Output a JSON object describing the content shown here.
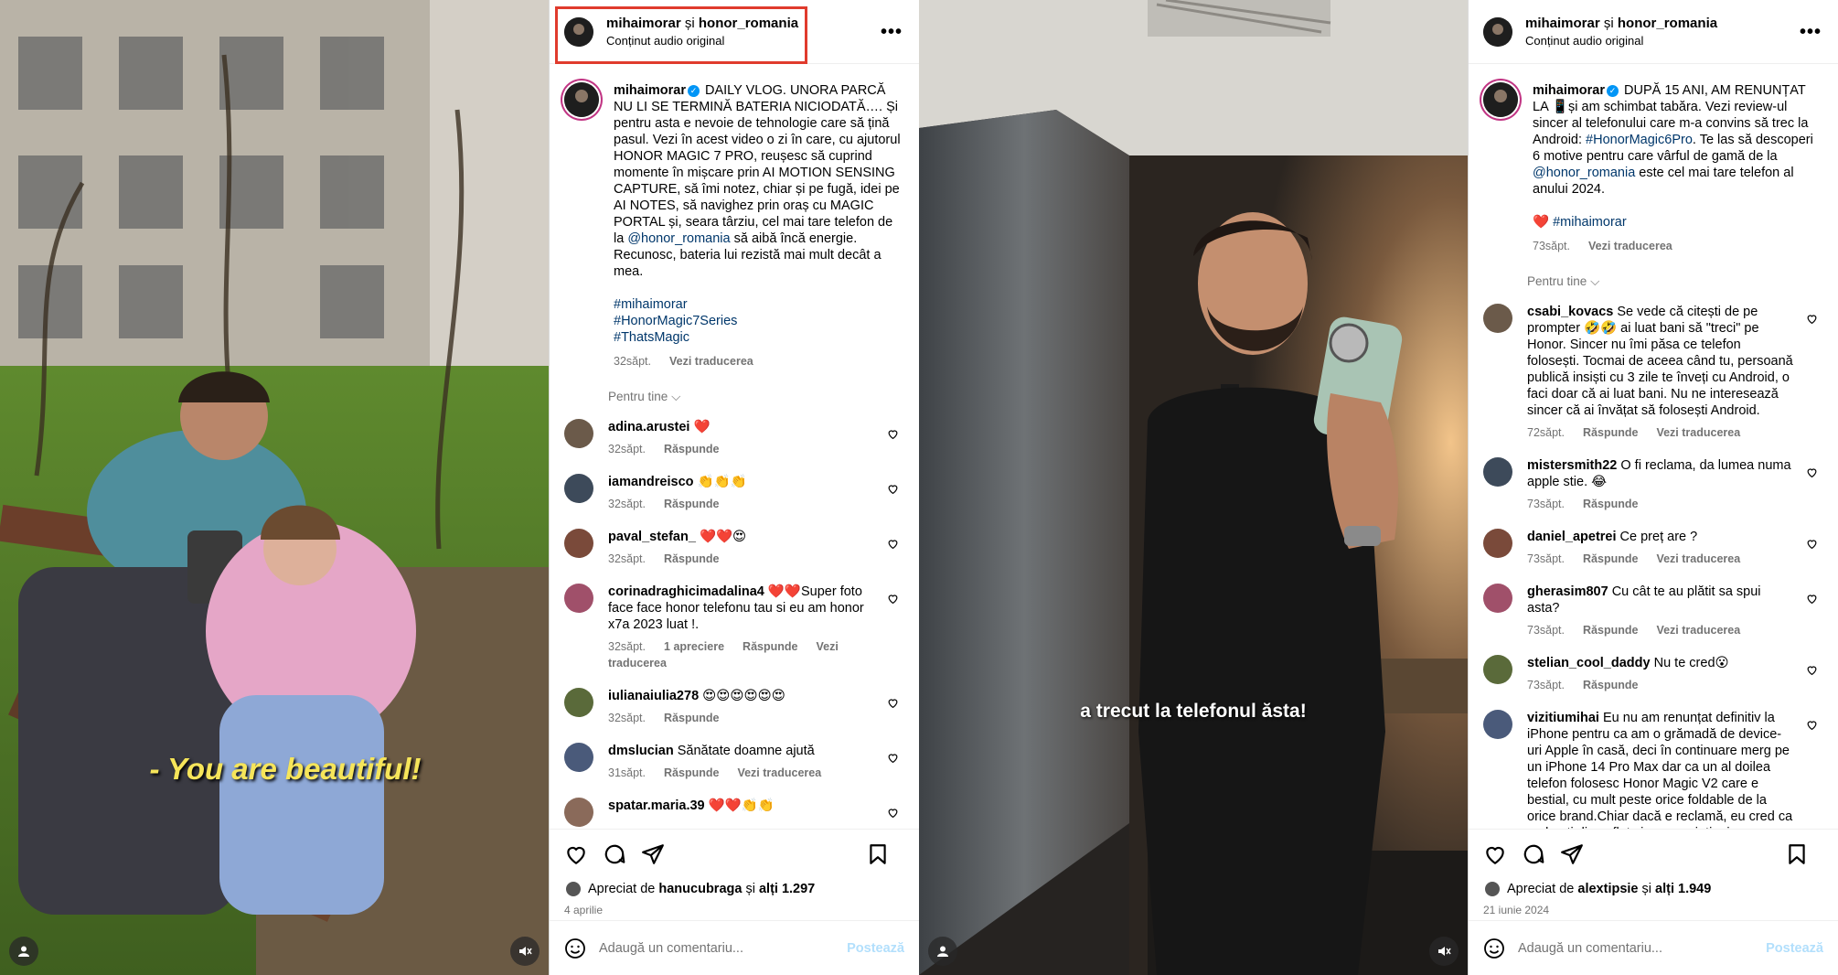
{
  "colors": {
    "accent_blue": "#0095f6",
    "link": "#00376b",
    "meta_gray": "#737373",
    "heart_red": "#ed4956",
    "highlight_box": "#e03b2d"
  },
  "left": {
    "video": {
      "caption": "- You are beautiful!"
    },
    "header": {
      "user1": "mihaimorar",
      "and": "și",
      "user2": "honor_romania",
      "subtitle": "Conținut audio original"
    },
    "post": {
      "username": "mihaimorar",
      "text": "DAILY VLOG. UNORA PARCĂ NU LI SE TERMINĂ BATERIA NICIODATĂ…. Și pentru asta e nevoie de tehnologie care să țină pasul. Vezi în acest video o zi în care, cu ajutorul HONOR MAGIC 7 PRO, reușesc să cuprind momente în mișcare prin AI MOTION SENSING CAPTURE, să îmi notez, chiar și pe fugă, idei pe AI NOTES, să navighez prin oraș cu MAGIC PORTAL și, seara târziu, cel mai tare telefon de la ",
      "mention": "@honor_romania",
      "text2": " să aibă încă energie. Recunosc, bateria lui rezistă mai mult decât a mea.",
      "hashtags": [
        "#mihaimorar",
        "#HonorMagic7Series",
        "#ThatsMagic"
      ],
      "time": "32săpt.",
      "translate": "Vezi traducerea"
    },
    "for_you": "Pentru tine",
    "comments": [
      {
        "user": "adina.arustei",
        "text": "❤️",
        "time": "32săpt.",
        "extra": "",
        "reply": "Răspunde",
        "trans": ""
      },
      {
        "user": "iamandreisco",
        "text": "👏👏👏",
        "time": "32săpt.",
        "extra": "",
        "reply": "Răspunde",
        "trans": ""
      },
      {
        "user": "paval_stefan_",
        "text": "❤️❤️😍",
        "time": "32săpt.",
        "extra": "",
        "reply": "Răspunde",
        "trans": ""
      },
      {
        "user": "corinadraghicimadalina4",
        "text": "❤️❤️Super foto face face honor telefonu tau si eu am honor x7a 2023 luat !.",
        "time": "32săpt.",
        "extra": "1 apreciere",
        "reply": "Răspunde",
        "trans": "Vezi traducerea"
      },
      {
        "user": "iulianaiulia278",
        "text": "😍😍😍😍😍😍",
        "time": "32săpt.",
        "extra": "",
        "reply": "Răspunde",
        "trans": ""
      },
      {
        "user": "dmslucian",
        "text": "Sănătate doamne ajută",
        "time": "31săpt.",
        "extra": "",
        "reply": "Răspunde",
        "trans": "Vezi traducerea"
      },
      {
        "user": "spatar.maria.39",
        "text": "❤️❤️👏👏",
        "time": "",
        "extra": "",
        "reply": "",
        "trans": ""
      }
    ],
    "likes": {
      "prefix": "Apreciat de",
      "user": "hanucubraga",
      "mid": "și",
      "others": "alți 1.297"
    },
    "date": "4 aprilie",
    "add_comment": "Adaugă un comentariu...",
    "post_btn": "Postează"
  },
  "right": {
    "video": {
      "caption": "a trecut la telefonul ăsta!"
    },
    "header": {
      "user1": "mihaimorar",
      "and": "și",
      "user2": "honor_romania",
      "subtitle": "Conținut audio original"
    },
    "post": {
      "username": "mihaimorar",
      "text": "DUPĂ 15 ANI, AM RENUNȚAT LA 📱și am schimbat tabăra. Vezi review-ul sincer al telefonului care m-a convins să trec la Android: ",
      "tag1": "#HonorMagic6Pro",
      "text2": ". Te las să descoperi 6 motive pentru care vârful de gamă de la ",
      "mention": "@honor_romania",
      "text3": " este cel mai tare telefon al anului 2024.",
      "heart": "❤️",
      "hashtag": "#mihaimorar",
      "time": "73săpt.",
      "translate": "Vezi traducerea"
    },
    "for_you": "Pentru tine",
    "comments": [
      {
        "user": "csabi_kovacs",
        "text": "Se vede că citești de pe prompter 🤣🤣 ai luat bani să \"treci\" pe Honor. Sincer nu îmi păsa ce telefon folosești. Tocmai de aceea când tu, persoană publică insiști cu 3 zile te înveți cu Android, o faci doar că ai luat bani. Nu ne interesează sincer că ai învățat să folosești Android.",
        "time": "72săpt.",
        "reply": "Răspunde",
        "trans": "Vezi traducerea"
      },
      {
        "user": "mistersmith22",
        "text": "O fi reclama, da lumea numa apple stie. 😂",
        "time": "73săpt.",
        "reply": "Răspunde",
        "trans": ""
      },
      {
        "user": "daniel_apetrei",
        "text": "Ce preț are ?",
        "time": "73săpt.",
        "reply": "Răspunde",
        "trans": "Vezi traducerea"
      },
      {
        "user": "gherasim807",
        "text": "Cu cât te au plătit sa spui asta?",
        "time": "73săpt.",
        "reply": "Răspunde",
        "trans": "Vezi traducerea"
      },
      {
        "user": "stelian_cool_daddy",
        "text": "Nu te cred😮",
        "time": "73săpt.",
        "reply": "Răspunde",
        "trans": ""
      },
      {
        "user": "vizitiumihai",
        "text": "Eu nu am renunțat definitiv la iPhone pentru ca am o grămadă de device-uri Apple în casă, deci în continuare merg pe un iPhone 14 Pro Max dar ca un al doilea telefon folosesc Honor Magic V2 care e bestial, cu mult peste orice foldable de la orice brand.Chiar dacă e reclamă, eu cred ca vorbești din suflet și nu ne minți, ai un",
        "time": "",
        "reply": "",
        "trans": ""
      }
    ],
    "likes": {
      "prefix": "Apreciat de",
      "user": "alextipsie",
      "mid": "și",
      "others": "alți 1.949"
    },
    "date": "21 iunie 2024",
    "add_comment": "Adaugă un comentariu...",
    "post_btn": "Postează"
  }
}
